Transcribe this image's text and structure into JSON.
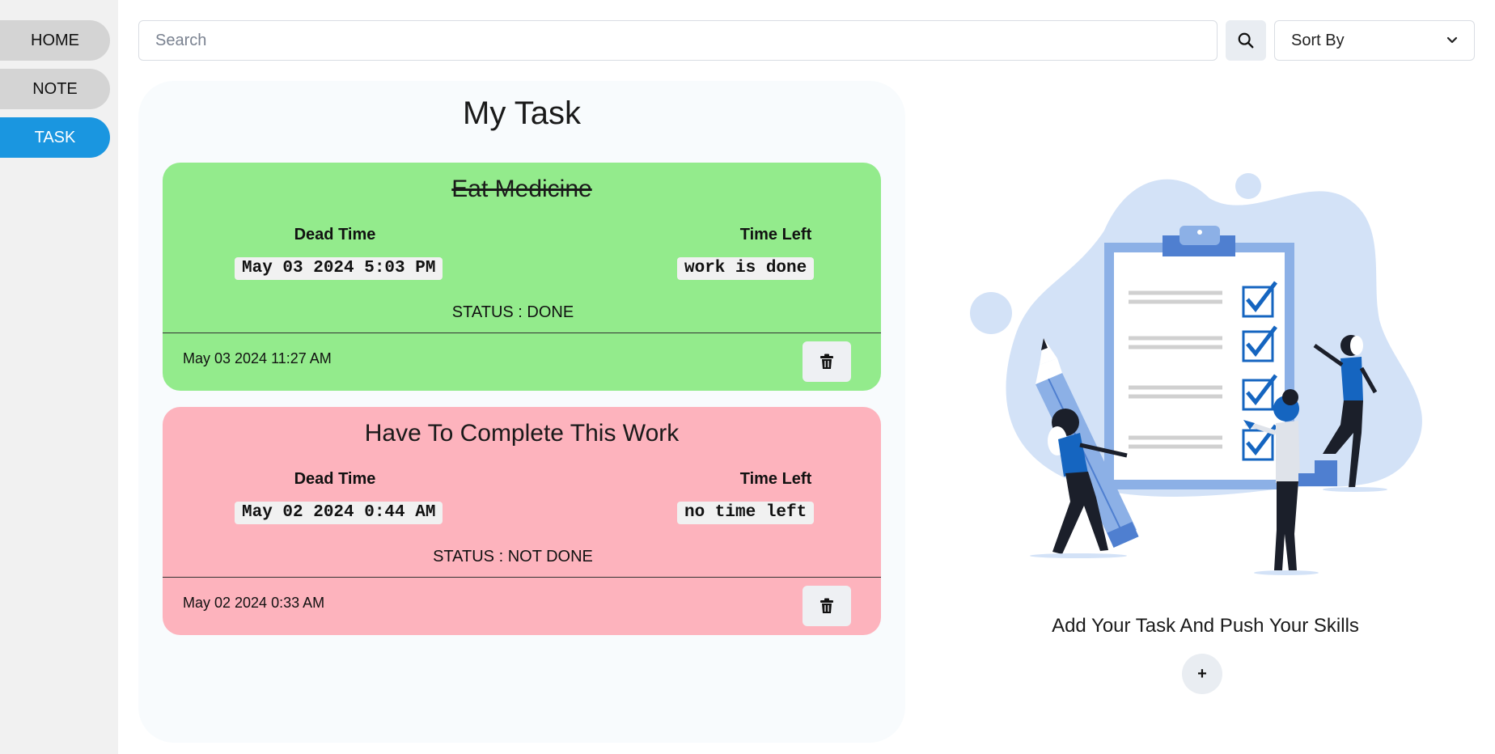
{
  "sidebar": {
    "items": [
      {
        "label": "HOME"
      },
      {
        "label": "NOTE"
      },
      {
        "label": "TASK",
        "active": true
      }
    ]
  },
  "search": {
    "placeholder": "Search",
    "value": ""
  },
  "sort": {
    "selected": "Sort By",
    "icon": "chevron-down-icon"
  },
  "panel": {
    "title": "My Task"
  },
  "tasks": [
    {
      "title": "Eat Medicine",
      "dead_time_label": "Dead Time",
      "dead_time": "May 03 2024 5:03 PM",
      "time_left_label": "Time Left",
      "time_left": "work is done",
      "status": "STATUS : DONE",
      "created": "May 03 2024 11:27 AM",
      "color": "#93eb8c",
      "completed": true
    },
    {
      "title": "Have To Complete This Work",
      "dead_time_label": "Dead Time",
      "dead_time": "May 02 2024 0:44 AM",
      "time_left_label": "Time Left",
      "time_left": "no time left",
      "status": "STATUS : NOT DONE",
      "created": "May 02 2024 0:33 AM",
      "color": "#fdb3bd",
      "completed": false
    }
  ],
  "right": {
    "tagline": "Add Your Task And Push Your Skills",
    "add_label": "+"
  },
  "colors": {
    "accent": "#1a96e0",
    "done": "#93eb8c",
    "not_done": "#fdb3bd",
    "illustration_blue": "#1565c0",
    "illustration_bg": "#d3e2f7"
  }
}
